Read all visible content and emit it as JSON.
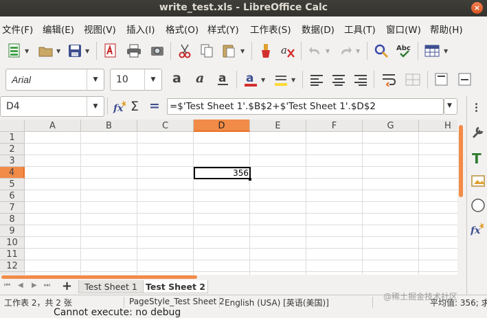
{
  "window": {
    "title": "write_test.xls - LibreOffice Calc",
    "close_glyph": "×"
  },
  "menu": [
    "文件(F)",
    "编辑(E)",
    "视图(V)",
    "插入(I)",
    "格式(O)",
    "样式(Y)",
    "工作表(S)",
    "数据(D)",
    "工具(T)",
    "窗口(W)",
    "帮助(H)"
  ],
  "format": {
    "font_name": "Arial",
    "font_size": "10"
  },
  "formula_bar": {
    "cell_ref": "D4",
    "formula": "=$'Test Sheet 1'.$B$2+$'Test Sheet 1'.$D$2",
    "sigma": "Σ",
    "equals": "="
  },
  "grid": {
    "columns": [
      "A",
      "B",
      "C",
      "D",
      "E",
      "F",
      "G",
      "H"
    ],
    "rows": [
      "1",
      "2",
      "3",
      "4",
      "5",
      "6",
      "7",
      "8",
      "9",
      "10",
      "11",
      "12"
    ],
    "active_column": "D",
    "active_row": "4",
    "cell_value": "356"
  },
  "sheet_tabs": {
    "items": [
      "Test Sheet 1",
      "Test Sheet 2"
    ],
    "active": "Test Sheet 2",
    "add_glyph": "+"
  },
  "status": {
    "sheet_info": "工作表 2，共 2 张",
    "page_style": "PageStyle_Test Sheet 2",
    "language": "English (USA) [英语(美国)]",
    "summary": "平均值: 356; 求",
    "watermark": "@稀土掘金技术社区"
  },
  "background_text": "Cannot execute: no debug",
  "colors": {
    "accent": "#f28b48",
    "titlebar": "#3a3935"
  }
}
